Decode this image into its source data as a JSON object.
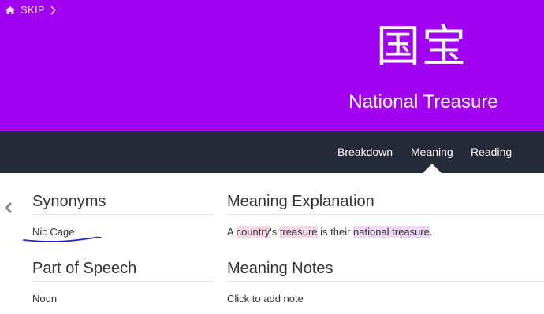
{
  "header": {
    "skip_label": "SKIP",
    "icons": {
      "home": "home-icon",
      "skip_chevron": "chevron-right-icon"
    },
    "kanji": "国宝",
    "meaning": "National Treasure",
    "background": "#a100f1"
  },
  "tabs": [
    {
      "label": "Breakdown"
    },
    {
      "label": "Meaning",
      "active": true
    },
    {
      "label": "Reading"
    }
  ],
  "tabbar_color": "#252a37",
  "nav": {
    "back_icon": "chevron-left-icon"
  },
  "synonyms": {
    "heading": "Synonyms",
    "value": "Nic Cage",
    "annotation": "hand-drawn blue underline",
    "annotation_color": "#1e22c9"
  },
  "meaning_explanation": {
    "heading": "Meaning Explanation",
    "parts": [
      "A ",
      "country",
      "'s ",
      "treasure",
      " is their ",
      "national treasure",
      "."
    ],
    "highlight_colors": {
      "radical": "#f9d7ea",
      "vocab": "#eed7f7"
    }
  },
  "part_of_speech": {
    "heading": "Part of Speech",
    "value": "Noun"
  },
  "meaning_notes": {
    "heading": "Meaning Notes",
    "placeholder": "Click to add note"
  }
}
